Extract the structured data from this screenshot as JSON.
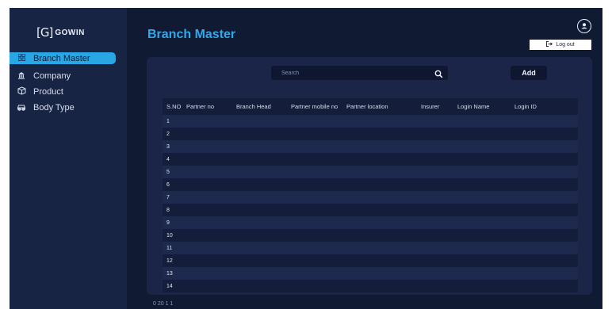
{
  "brand": {
    "mark": "[G]",
    "name": "GOWIN"
  },
  "sidebar": {
    "items": [
      {
        "label": "Branch Master",
        "icon": "grid-icon",
        "active": true
      },
      {
        "label": "Company",
        "icon": "bank-icon",
        "active": false
      },
      {
        "label": "Product",
        "icon": "box-icon",
        "active": false
      },
      {
        "label": "Body Type",
        "icon": "car-icon",
        "active": false
      }
    ]
  },
  "header": {
    "title": "Branch Master",
    "logout_label": "Log out"
  },
  "search": {
    "placeholder": "Search"
  },
  "toolbar": {
    "add_label": "Add"
  },
  "table": {
    "columns": [
      "S.NO",
      "Partner no",
      "Branch Head",
      "Partner mobile no",
      "Partner location",
      "Insurer",
      "Login Name",
      "Login ID"
    ],
    "rows": [
      "1",
      "2",
      "3",
      "4",
      "5",
      "6",
      "7",
      "8",
      "9",
      "10",
      "11",
      "12",
      "13",
      "14"
    ]
  },
  "footer": {
    "text": "0 20 1 1"
  },
  "colors": {
    "accent": "#29a7e4",
    "title": "#2fa9ec",
    "background": "#111a33",
    "sidebar": "#172443",
    "panel": "#1a2547"
  }
}
